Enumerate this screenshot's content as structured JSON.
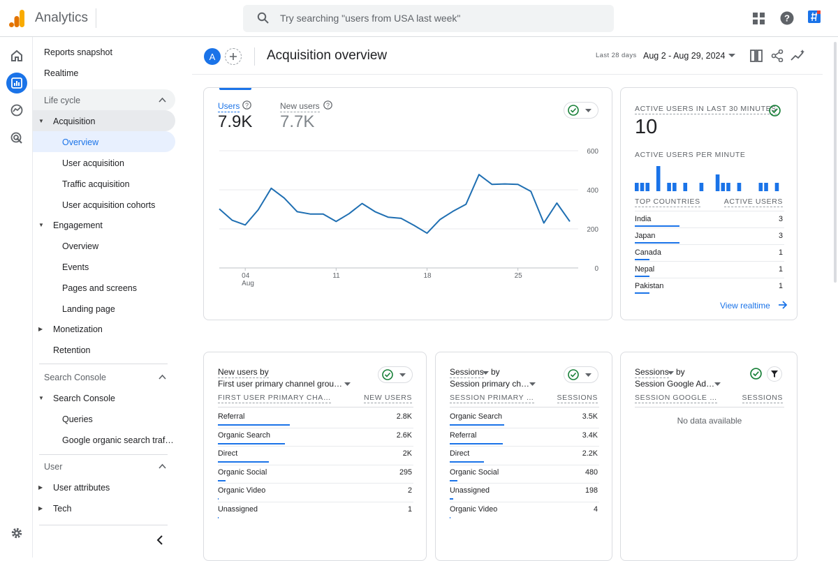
{
  "app": {
    "title": "Analytics"
  },
  "search": {
    "placeholder": "Try searching \"users from USA last week\""
  },
  "sidebar": {
    "top_items": [
      "Reports snapshot",
      "Realtime"
    ],
    "lifecycle": {
      "label": "Life cycle"
    },
    "acquisition": {
      "label": "Acquisition",
      "items": [
        "Overview",
        "User acquisition",
        "Traffic acquisition",
        "User acquisition cohorts"
      ]
    },
    "engagement": {
      "label": "Engagement",
      "items": [
        "Overview",
        "Events",
        "Pages and screens",
        "Landing page"
      ]
    },
    "monetization": "Monetization",
    "retention": "Retention",
    "search_console_section": "Search Console",
    "search_console": {
      "label": "Search Console",
      "items": [
        "Queries",
        "Google organic search traf…"
      ]
    },
    "user_section": "User",
    "user_attributes": "User attributes",
    "tech": "Tech"
  },
  "header": {
    "avatar": "A",
    "title": "Acquisition overview",
    "range_label": "Last 28 days",
    "range": "Aug 2 - Aug 29, 2024"
  },
  "users_card": {
    "metrics": [
      {
        "label": "Users",
        "value": "7.9K"
      },
      {
        "label": "New users",
        "value": "7.7K"
      }
    ],
    "x_ticks": [
      "04",
      "11",
      "18",
      "25"
    ],
    "x_month": "Aug",
    "y_ticks": [
      "600",
      "400",
      "200",
      "0"
    ]
  },
  "chart_data": {
    "type": "line",
    "series": [
      {
        "name": "Users",
        "values": [
          302,
          244,
          220,
          298,
          408,
          358,
          288,
          276,
          276,
          238,
          278,
          330,
          288,
          260,
          254,
          218,
          178,
          248,
          290,
          326,
          478,
          428,
          430,
          428,
          392,
          230,
          332,
          238
        ]
      }
    ],
    "x_range": [
      "Aug 2",
      "Aug 29"
    ],
    "ylim": [
      0,
      600
    ],
    "y_ticks": [
      0,
      200,
      400,
      600
    ]
  },
  "realtime_card": {
    "title": "Active users in last 30 minutes",
    "value": "10",
    "per_minute_label": "Active users per minute",
    "per_minute": [
      1,
      1,
      1,
      0,
      3,
      0,
      1,
      1,
      0,
      1,
      0,
      0,
      1,
      0,
      0,
      2,
      1,
      1,
      0,
      1,
      0,
      0,
      0,
      1,
      1,
      0,
      1,
      0
    ],
    "countries_header": "Top countries",
    "users_header": "Active users",
    "countries": [
      {
        "name": "India",
        "value": "3",
        "share": 1.0
      },
      {
        "name": "Japan",
        "value": "3",
        "share": 1.0
      },
      {
        "name": "Canada",
        "value": "1",
        "share": 0.33
      },
      {
        "name": "Nepal",
        "value": "1",
        "share": 0.33
      },
      {
        "name": "Pakistan",
        "value": "1",
        "share": 0.33
      }
    ],
    "view_link": "View realtime"
  },
  "card_new_users": {
    "title_line1": "New users by",
    "title_line2": "First user primary channel grou…",
    "col1": "First user primary cha…",
    "col2": "New users",
    "rows": [
      {
        "label": "Referral",
        "value": "2.8K",
        "share": 1.0
      },
      {
        "label": "Organic Search",
        "value": "2.6K",
        "share": 0.93
      },
      {
        "label": "Direct",
        "value": "2K",
        "share": 0.71
      },
      {
        "label": "Organic Social",
        "value": "295",
        "share": 0.11
      },
      {
        "label": "Organic Video",
        "value": "2",
        "share": 0.01
      },
      {
        "label": "Unassigned",
        "value": "1",
        "share": 0.0
      }
    ]
  },
  "card_sessions": {
    "title_line1": "Sessions",
    "title_by": "by",
    "title_line2": "Session primary ch…",
    "col1": "Session primary …",
    "col2": "Sessions",
    "rows": [
      {
        "label": "Organic Search",
        "value": "3.5K",
        "share": 1.0
      },
      {
        "label": "Referral",
        "value": "3.4K",
        "share": 0.97
      },
      {
        "label": "Direct",
        "value": "2.2K",
        "share": 0.63
      },
      {
        "label": "Organic Social",
        "value": "480",
        "share": 0.14
      },
      {
        "label": "Unassigned",
        "value": "198",
        "share": 0.06
      },
      {
        "label": "Organic Video",
        "value": "4",
        "share": 0.01
      }
    ]
  },
  "card_sessions_ads": {
    "title_line1": "Sessions",
    "title_by": "by",
    "title_line2": "Session Google Ad…",
    "col1": "Session Google …",
    "col2": "Sessions",
    "empty": "No data available"
  },
  "colors": {
    "accent": "#1a73e8",
    "line": "#1f6fb2",
    "bars": "#1a73e8",
    "check": "#188038"
  }
}
